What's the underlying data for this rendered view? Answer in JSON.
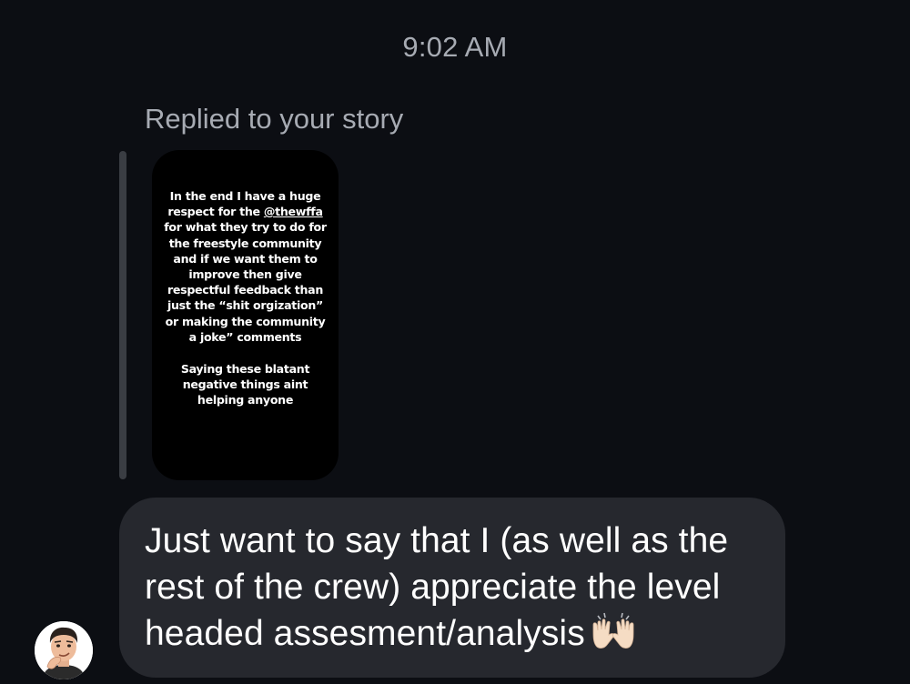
{
  "chat": {
    "timestamp": "9:02 AM",
    "reply_label": "Replied to your story",
    "story": {
      "paragraph1_before_mention": "In the end I have a huge respect for the ",
      "mention": "@thewffa",
      "paragraph1_after_mention": " for what they try to do for the freestyle community and if we want them to improve then give respectful feedback than just the “shit orgization” or making the community a joke” comments",
      "paragraph2": "Saying these blatant negative things aint helping anyone"
    },
    "message": {
      "text": "Just want to say that I (as well as the rest of the crew) appreciate the level headed assesment/analysis",
      "emoji": "raising-hands-emoji"
    },
    "sender_avatar": "cartoon-person-avatar"
  }
}
